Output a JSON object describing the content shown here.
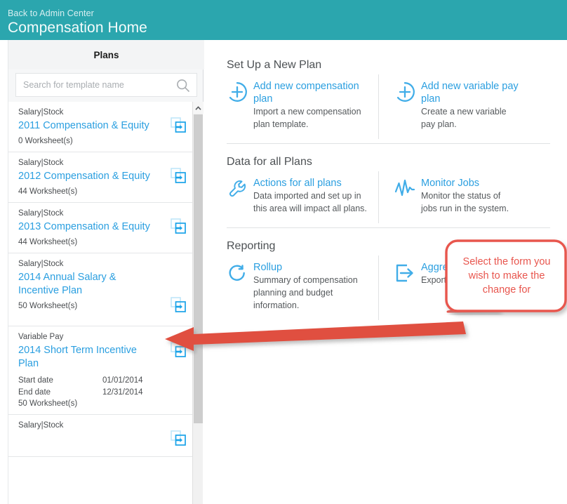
{
  "header": {
    "breadcrumb": "Back to Admin Center",
    "title": "Compensation Home",
    "bg_color": "#2ba6ae"
  },
  "sidebar": {
    "panel_title": "Plans",
    "search": {
      "placeholder": "Search for template name",
      "value": "",
      "icon": "search-icon"
    },
    "collapse_icon": "chevron-left-icon",
    "scrollbar": {
      "up_icon": "chevron-up-icon"
    },
    "plans": [
      {
        "type": "Salary|Stock",
        "name": "2011 Compensation & Equity",
        "worksheets": "0 Worksheet(s)",
        "copy_icon": "duplicate-icon"
      },
      {
        "type": "Salary|Stock",
        "name": "2012 Compensation & Equity",
        "worksheets": "44 Worksheet(s)",
        "copy_icon": "duplicate-icon"
      },
      {
        "type": "Salary|Stock",
        "name": "2013 Compensation & Equity",
        "worksheets": "44 Worksheet(s)",
        "copy_icon": "duplicate-icon"
      },
      {
        "type": "Salary|Stock",
        "name": "2014 Annual Salary & Incentive Plan",
        "worksheets": "50 Worksheet(s)",
        "copy_icon": "duplicate-icon"
      },
      {
        "type": "Variable Pay",
        "name": "2014 Short Term Incentive Plan",
        "start_label": "Start date",
        "start_value": "01/01/2014",
        "end_label": "End date",
        "end_value": "12/31/2014",
        "worksheets": "50 Worksheet(s)",
        "copy_icon": "duplicate-icon"
      },
      {
        "type": "Salary|Stock",
        "name": "",
        "worksheets": "",
        "copy_icon": "duplicate-icon"
      }
    ]
  },
  "main": {
    "sections": [
      {
        "title": "Set Up a New Plan",
        "tiles": [
          {
            "icon": "circle-plus-icon",
            "link": "Add new compensation plan",
            "desc": "Import a new compensation plan template."
          },
          {
            "icon": "circle-plus-icon",
            "link": "Add new variable pay plan",
            "desc": "Create a new variable pay plan."
          }
        ]
      },
      {
        "title": "Data for all Plans",
        "tiles": [
          {
            "icon": "wrench-icon",
            "link": "Actions for all plans",
            "desc": "Data imported and set up in this area will impact all plans."
          },
          {
            "icon": "activity-pulse-icon",
            "link": "Monitor Jobs",
            "desc": "Monitor the status of jobs run in the system."
          }
        ]
      },
      {
        "title": "Reporting",
        "tiles": [
          {
            "icon": "refresh-circle-icon",
            "link": "Rollup",
            "desc": "Summary of compensation planning and budget information."
          },
          {
            "icon": "export-arrow-icon",
            "link": "Aggreg",
            "desc": "Export a data fro"
          }
        ]
      }
    ]
  },
  "annotation": {
    "callout_text": "Select the form you wish to make the change for",
    "callout_color": "#e8564e",
    "arrow_color": "#e0503f",
    "arrow_icon": "left-arrow-annotation",
    "callout_icon": "speech-bubble-annotation"
  },
  "colors": {
    "teal": "#2ba6ae",
    "link_blue": "#2b9fe0",
    "icon_blue": "#41ade8",
    "annotation_red": "#e8564e",
    "text_dark": "#4a4d50"
  }
}
